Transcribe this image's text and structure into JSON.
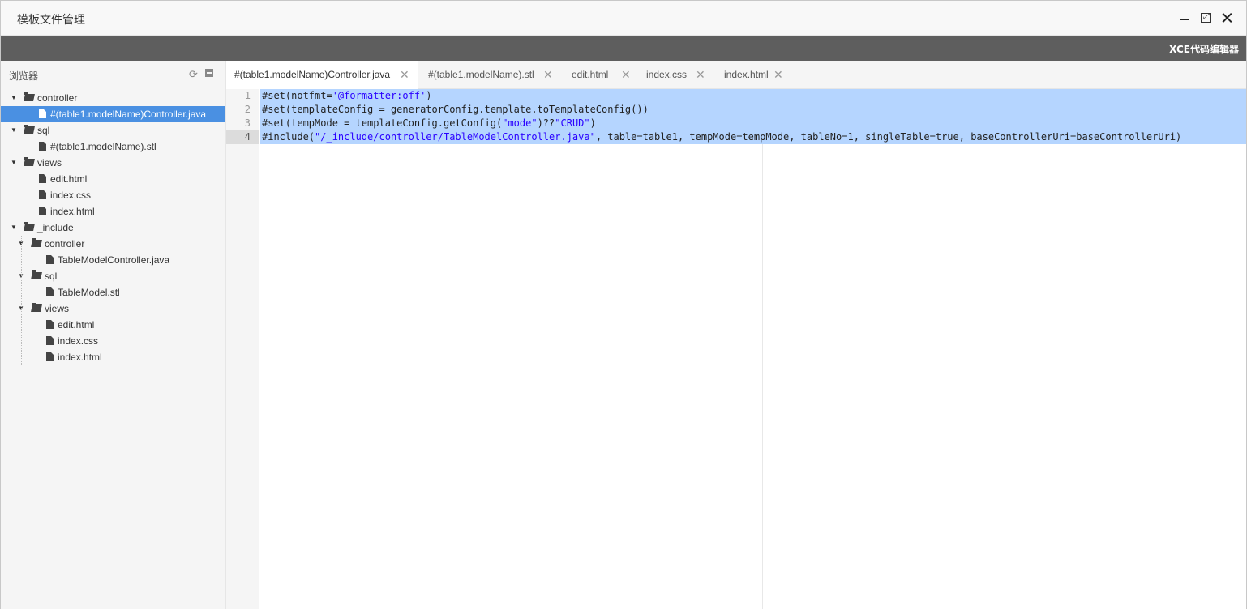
{
  "window": {
    "title": "模板文件管理",
    "controls": [
      "minimize-icon",
      "maximize-icon",
      "close-icon"
    ]
  },
  "toolbar": {
    "brand": "XCE代码编辑器"
  },
  "sidebar": {
    "header": "浏览器",
    "icons": [
      "refresh-icon",
      "collapse-icon"
    ],
    "tree": [
      {
        "type": "folder",
        "label": "controller",
        "depth": 0
      },
      {
        "type": "file",
        "label": "#(table1.modelName)Controller.java",
        "depth": 1,
        "selected": true
      },
      {
        "type": "folder",
        "label": "sql",
        "depth": 0
      },
      {
        "type": "file",
        "label": "#(table1.modelName).stl",
        "depth": 1
      },
      {
        "type": "folder",
        "label": "views",
        "depth": 0
      },
      {
        "type": "file",
        "label": "edit.html",
        "depth": 1
      },
      {
        "type": "file",
        "label": "index.css",
        "depth": 1
      },
      {
        "type": "file",
        "label": "index.html",
        "depth": 1
      },
      {
        "type": "folder",
        "label": "_include",
        "depth": 0
      },
      {
        "type": "folder",
        "label": "controller",
        "depth": 1
      },
      {
        "type": "file",
        "label": "TableModelController.java",
        "depth": 2
      },
      {
        "type": "folder",
        "label": "sql",
        "depth": 1
      },
      {
        "type": "file",
        "label": "TableModel.stl",
        "depth": 2
      },
      {
        "type": "folder",
        "label": "views",
        "depth": 1
      },
      {
        "type": "file",
        "label": "edit.html",
        "depth": 2
      },
      {
        "type": "file",
        "label": "index.css",
        "depth": 2
      },
      {
        "type": "file",
        "label": "index.html",
        "depth": 2
      }
    ]
  },
  "tabs": [
    {
      "label": "#(table1.modelName)Controller.java",
      "active": true
    },
    {
      "label": "#(table1.modelName).stl"
    },
    {
      "label": "edit.html"
    },
    {
      "label": "index.css"
    },
    {
      "label": "index.html"
    }
  ],
  "editor": {
    "current_line": 4,
    "lines": [
      {
        "no": "1",
        "parts": [
          [
            "#set(notfmt=",
            ""
          ],
          [
            "'@formatter:off'",
            "str"
          ],
          [
            ")",
            ""
          ]
        ]
      },
      {
        "no": "2",
        "parts": [
          [
            "#set(templateConfig = generatorConfig.template.toTemplateConfig())",
            ""
          ]
        ]
      },
      {
        "no": "3",
        "parts": [
          [
            "#set(tempMode = templateConfig.getConfig(",
            ""
          ],
          [
            "\"mode\"",
            "str"
          ],
          [
            ")??",
            ""
          ],
          [
            "\"CRUD\"",
            "str"
          ],
          [
            ")",
            ""
          ]
        ]
      },
      {
        "no": "4",
        "parts": [
          [
            "#include(",
            ""
          ],
          [
            "\"/_include/controller/TableModelController.java\"",
            "str"
          ],
          [
            ", table=table1, tempMode=tempMode, tableNo=1, singleTable=true, baseControllerUri=baseControllerUri)",
            ""
          ]
        ]
      }
    ]
  }
}
